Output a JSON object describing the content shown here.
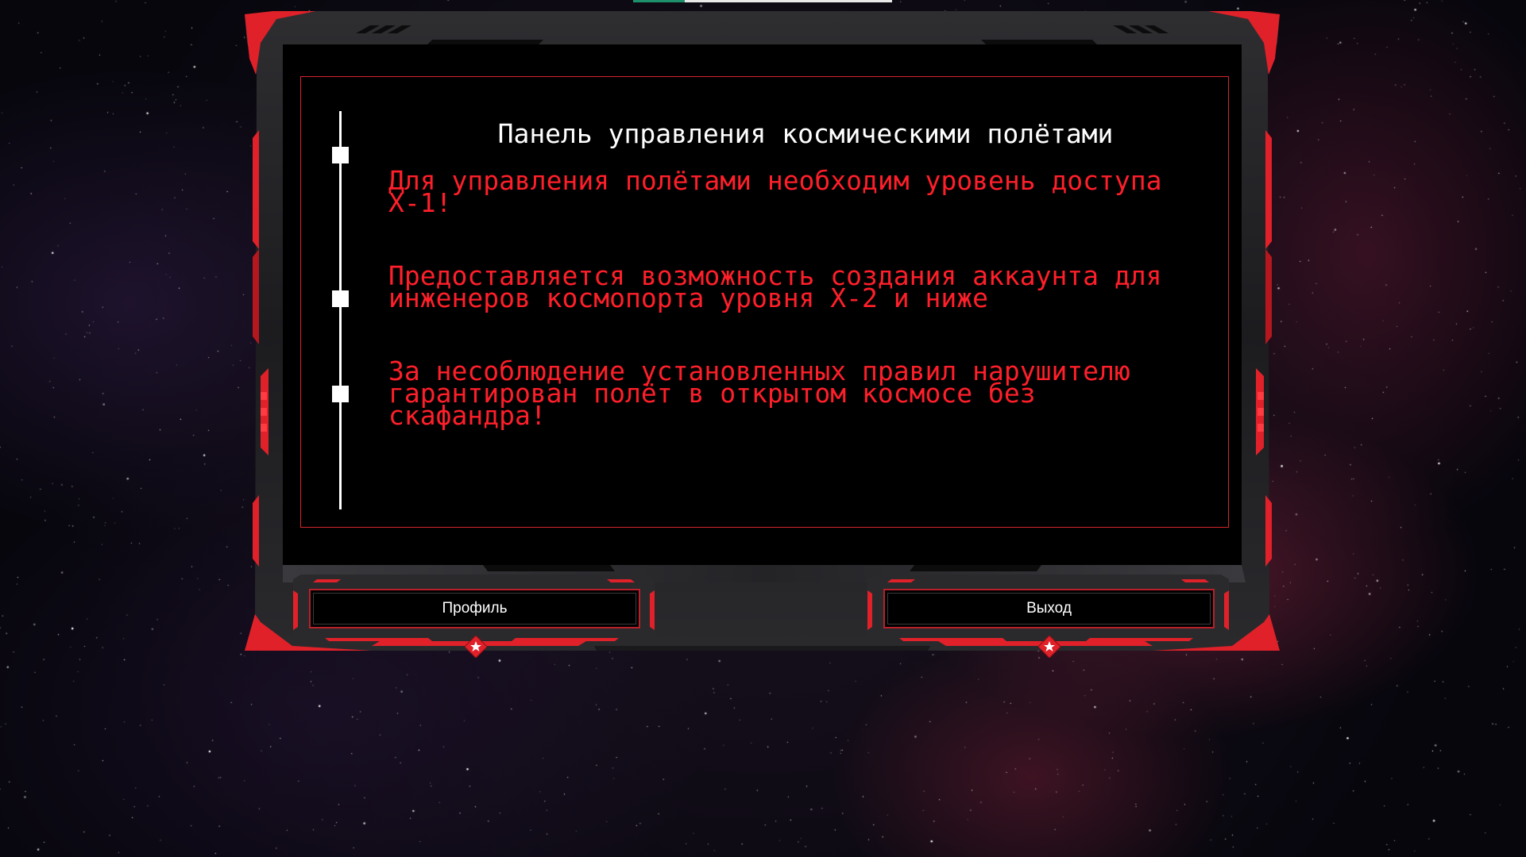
{
  "panel": {
    "title": "Панель управления космическими полётами",
    "notices": [
      "Для управления полётами необходим уровень доступа Х-1!",
      "Предоставляется возможность создания аккаунта для инженеров космопорта уровня Х-2 и ниже",
      "За несоблюдение установленных правил нарушителю гарантирован полёт в открытом космосе без скафандра!"
    ]
  },
  "buttons": {
    "profile_label": "Профиль",
    "logout_label": "Выход"
  },
  "icons": {
    "button_badge": "star-icon"
  },
  "colors": {
    "accent_red": "#e8202b",
    "notice_text": "#ff1f2a",
    "title_text": "#ffffff",
    "screen_bg": "#000000"
  }
}
